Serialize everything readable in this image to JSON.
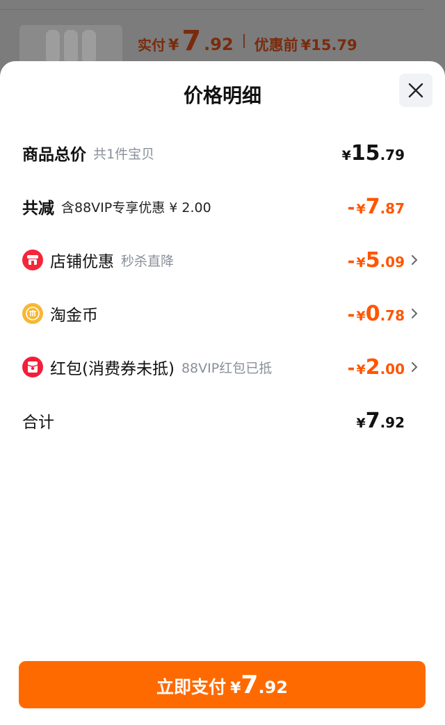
{
  "background": {
    "paid_label": "实付",
    "currency": "¥",
    "paid_int": "7",
    "paid_dec": ".92",
    "before_label": "优惠前",
    "before_value": "¥15.79"
  },
  "sheet": {
    "title": "价格明细",
    "close_icon": "close-icon"
  },
  "rows": {
    "total_goods": {
      "label": "商品总价",
      "sub": "共1件宝贝",
      "currency": "¥",
      "int": "15",
      "dec": ".79"
    },
    "reduction": {
      "label": "共减",
      "sub": "含88VIP专享优惠 ¥ 2.00",
      "minus": "-",
      "currency": "¥",
      "int": "7",
      "dec": ".87"
    },
    "shop_discount": {
      "label": "店铺优惠",
      "sub": "秒杀直降",
      "minus": "-",
      "currency": "¥",
      "int": "5",
      "dec": ".09",
      "icon": "shop-icon"
    },
    "taojinbi": {
      "label": "淘金币",
      "minus": "-",
      "currency": "¥",
      "int": "0",
      "dec": ".78",
      "icon": "coin-icon"
    },
    "redpacket": {
      "label": "红包(消费券未抵)",
      "sub": "88VIP红包已抵",
      "minus": "-",
      "currency": "¥",
      "int": "2",
      "dec": ".00",
      "icon": "red-packet-icon"
    },
    "sum": {
      "label": "合计",
      "currency": "¥",
      "int": "7",
      "dec": ".92"
    }
  },
  "pay_button": {
    "label": "立即支付",
    "currency": "¥",
    "int": "7",
    "dec": ".92"
  },
  "colors": {
    "accent": "#ff6a00",
    "discount": "#ff5500",
    "shop": "#f5263a",
    "coin": "#f7b733",
    "redpacket": "#f21f3b"
  }
}
